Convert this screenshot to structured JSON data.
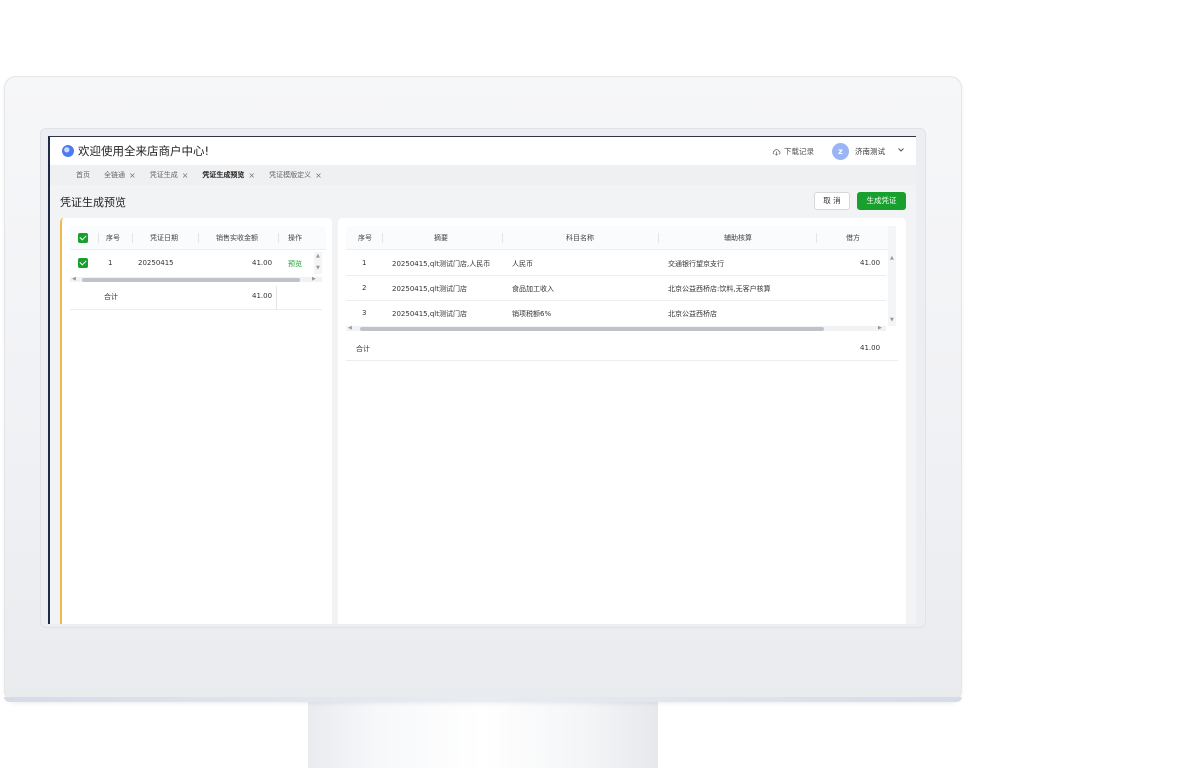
{
  "app": {
    "title": "欢迎使用全来店商户中心!",
    "download_label": "下载记录",
    "avatar_letter": "z",
    "user_name": "济南测试"
  },
  "tabs": [
    {
      "label": "首页",
      "closable": false,
      "active": false
    },
    {
      "label": "全链通",
      "closable": true,
      "active": false
    },
    {
      "label": "凭证生成",
      "closable": true,
      "active": false
    },
    {
      "label": "凭证生成预览",
      "closable": true,
      "active": true
    },
    {
      "label": "凭证模版定义",
      "closable": true,
      "active": false
    }
  ],
  "tab_close_glyph": "×",
  "page": {
    "title": "凭证生成预览",
    "cancel_label": "取 消",
    "generate_label": "生成凭证"
  },
  "left_table": {
    "headers": [
      "序号",
      "凭证日期",
      "销售实收金额",
      "操作"
    ],
    "rows": [
      {
        "index": "1",
        "date": "20250415",
        "amount": "41.00",
        "action": "预览",
        "checked": true
      }
    ],
    "total_label": "合计",
    "total_amount": "41.00"
  },
  "right_table": {
    "headers": [
      "序号",
      "摘要",
      "科目名称",
      "辅助核算",
      "借方"
    ],
    "rows": [
      {
        "index": "1",
        "summary": "20250415,qlt测试门店,人民币",
        "subject": "人民币",
        "aux": "交通银行望京支行",
        "debit": "41.00"
      },
      {
        "index": "2",
        "summary": "20250415,qlt测试门店",
        "subject": "食品加工收入",
        "aux": "北京公益西桥店:饮料,无客户核算",
        "debit": ""
      },
      {
        "index": "3",
        "summary": "20250415,qlt测试门店",
        "subject": "销项税额6%",
        "aux": "北京公益西桥店",
        "debit": ""
      }
    ],
    "total_label": "合计",
    "total_debit": "41.00"
  },
  "colors": {
    "accent_green": "#17a02e",
    "panel_accent": "#f1b84b",
    "avatar_bg": "#9bb5f4"
  }
}
